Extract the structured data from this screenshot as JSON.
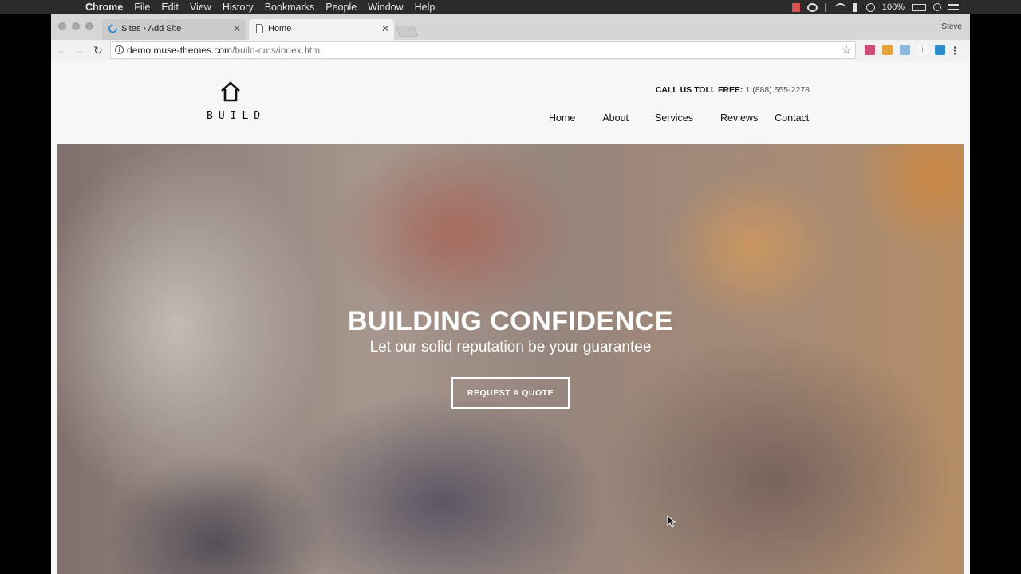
{
  "menubar": {
    "app": "Chrome",
    "items": [
      "File",
      "Edit",
      "View",
      "History",
      "Bookmarks",
      "People",
      "Window",
      "Help"
    ],
    "battery": "100%"
  },
  "browser": {
    "tabs": [
      {
        "title": "Sites › Add Site",
        "active": false
      },
      {
        "title": "Home",
        "active": true
      }
    ],
    "profile": "Steve",
    "url_host": "demo.muse-themes.com",
    "url_path": "/build-cms/index.html"
  },
  "site": {
    "logo_text": "BUILD",
    "toll_free_label": "CALL US TOLL FREE:",
    "toll_free_number": "1 (888) 555-2278",
    "nav": [
      "Home",
      "About",
      "Services",
      "Reviews",
      "Contact"
    ],
    "hero": {
      "title": "BUILDING CONFIDENCE",
      "subtitle": "Let our solid reputation be your guarantee",
      "cta": "REQUEST A QUOTE"
    }
  },
  "colors": {
    "menubar_bg": "#2b2b2b",
    "page_bg": "#f7f7f7",
    "hero_text": "#ffffff"
  }
}
